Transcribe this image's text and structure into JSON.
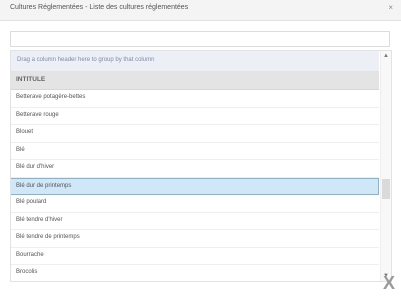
{
  "dialog": {
    "title": "Cultures Réglementées - Liste des cultures réglementées",
    "title_close": "×",
    "close_button": "X"
  },
  "search": {
    "value": "",
    "placeholder": ""
  },
  "grid": {
    "group_panel_text": "Drag a column header here to group by that column",
    "column_header": "INTITULE",
    "rows": [
      "Betterave potagère-bettes",
      "Betterave rouge",
      "Blouet",
      "Blé",
      "Blé dur d'hiver",
      "Blé dur de printemps",
      "Blé poulard",
      "Blé tendre d'hiver",
      "Blé tendre de printemps",
      "Bourrache",
      "Brocolis"
    ],
    "selected_row": "Blé dur de printemps"
  },
  "scrollbar": {
    "up_arrow": "▲",
    "down_arrow": "▼"
  }
}
